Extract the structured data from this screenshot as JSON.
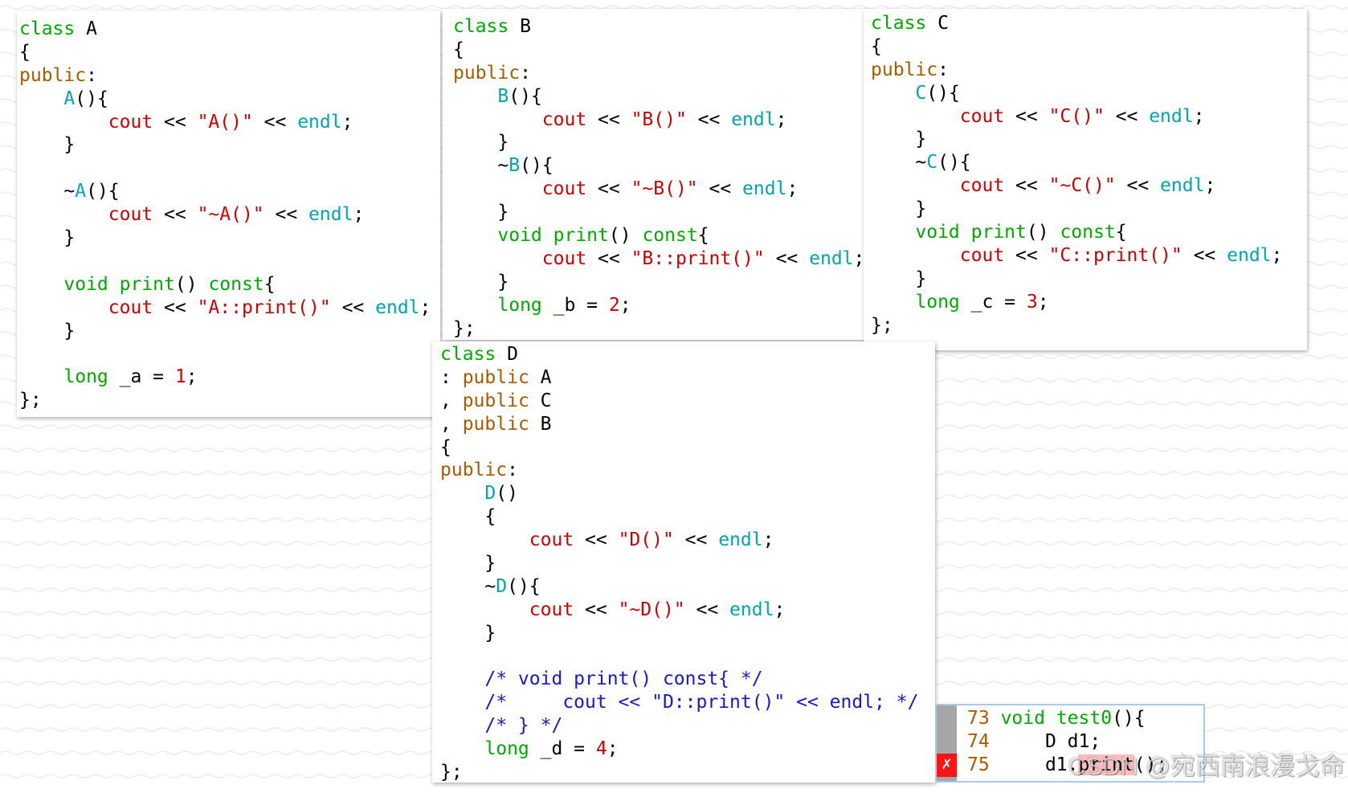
{
  "background": {
    "wave_color": "#ebebeb"
  },
  "panels": [
    {
      "lines": [
        [
          [
            "class",
            "#00aa00"
          ],
          [
            " A"
          ]
        ],
        [
          [
            "{"
          ]
        ],
        [
          [
            "public",
            "#aa5a00"
          ],
          [
            ":"
          ]
        ],
        [
          [
            "    "
          ],
          [
            "A",
            "#00a5b0"
          ],
          [
            "(){"
          ]
        ],
        [
          [
            "        "
          ],
          [
            "cout",
            "#d00000"
          ],
          [
            " << "
          ],
          [
            "\"A()\"",
            "#d00000"
          ],
          [
            " << "
          ],
          [
            "endl",
            "#00a5b0"
          ],
          [
            ";"
          ]
        ],
        [
          [
            "    }"
          ]
        ],
        [],
        [
          [
            "    ~"
          ],
          [
            "A",
            "#00a5b0"
          ],
          [
            "(){"
          ]
        ],
        [
          [
            "        "
          ],
          [
            "cout",
            "#d00000"
          ],
          [
            " << "
          ],
          [
            "\"~A()\"",
            "#d00000"
          ],
          [
            " << "
          ],
          [
            "endl",
            "#00a5b0"
          ],
          [
            ";"
          ]
        ],
        [
          [
            "    }"
          ]
        ],
        [],
        [
          [
            "    "
          ],
          [
            "void",
            "#00aa00"
          ],
          [
            " "
          ],
          [
            "print",
            "#00aa00"
          ],
          [
            "() "
          ],
          [
            "const",
            "#00aa00"
          ],
          [
            "{"
          ]
        ],
        [
          [
            "        "
          ],
          [
            "cout",
            "#d00000"
          ],
          [
            " << "
          ],
          [
            "\"A::print()\"",
            "#d00000"
          ],
          [
            " << "
          ],
          [
            "endl",
            "#00a5b0"
          ],
          [
            ";"
          ]
        ],
        [
          [
            "    }"
          ]
        ],
        [],
        [
          [
            "    "
          ],
          [
            "long",
            "#00aa00"
          ],
          [
            " _a = "
          ],
          [
            "1",
            "#d00000"
          ],
          [
            ";"
          ]
        ],
        [
          [
            "};"
          ]
        ]
      ]
    },
    {
      "lines": [
        [
          [
            "class",
            "#00aa00"
          ],
          [
            " B"
          ]
        ],
        [
          [
            "{"
          ]
        ],
        [
          [
            "public",
            "#aa5a00"
          ],
          [
            ":"
          ]
        ],
        [
          [
            "    "
          ],
          [
            "B",
            "#00a5b0"
          ],
          [
            "(){"
          ]
        ],
        [
          [
            "        "
          ],
          [
            "cout",
            "#d00000"
          ],
          [
            " << "
          ],
          [
            "\"B()\"",
            "#d00000"
          ],
          [
            " << "
          ],
          [
            "endl",
            "#00a5b0"
          ],
          [
            ";"
          ]
        ],
        [
          [
            "    }"
          ]
        ],
        [
          [
            "    ~"
          ],
          [
            "B",
            "#00a5b0"
          ],
          [
            "(){"
          ]
        ],
        [
          [
            "        "
          ],
          [
            "cout",
            "#d00000"
          ],
          [
            " << "
          ],
          [
            "\"~B()\"",
            "#d00000"
          ],
          [
            " << "
          ],
          [
            "endl",
            "#00a5b0"
          ],
          [
            ";"
          ]
        ],
        [
          [
            "    }"
          ]
        ],
        [
          [
            "    "
          ],
          [
            "void",
            "#00aa00"
          ],
          [
            " "
          ],
          [
            "print",
            "#00aa00"
          ],
          [
            "() "
          ],
          [
            "const",
            "#00aa00"
          ],
          [
            "{"
          ]
        ],
        [
          [
            "        "
          ],
          [
            "cout",
            "#d00000"
          ],
          [
            " << "
          ],
          [
            "\"B::print()\"",
            "#d00000"
          ],
          [
            " << "
          ],
          [
            "endl",
            "#00a5b0"
          ],
          [
            ";"
          ]
        ],
        [
          [
            "    }"
          ]
        ],
        [
          [
            "    "
          ],
          [
            "long",
            "#00aa00"
          ],
          [
            " _b = "
          ],
          [
            "2",
            "#d00000"
          ],
          [
            ";"
          ]
        ],
        [
          [
            "};"
          ]
        ]
      ]
    },
    {
      "lines": [
        [
          [
            "class",
            "#00aa00"
          ],
          [
            " C"
          ]
        ],
        [
          [
            "{"
          ]
        ],
        [
          [
            "public",
            "#aa5a00"
          ],
          [
            ":"
          ]
        ],
        [
          [
            "    "
          ],
          [
            "C",
            "#00a5b0"
          ],
          [
            "(){"
          ]
        ],
        [
          [
            "        "
          ],
          [
            "cout",
            "#d00000"
          ],
          [
            " << "
          ],
          [
            "\"C()\"",
            "#d00000"
          ],
          [
            " << "
          ],
          [
            "endl",
            "#00a5b0"
          ],
          [
            ";"
          ]
        ],
        [
          [
            "    }"
          ]
        ],
        [
          [
            "    ~"
          ],
          [
            "C",
            "#00a5b0"
          ],
          [
            "(){"
          ]
        ],
        [
          [
            "        "
          ],
          [
            "cout",
            "#d00000"
          ],
          [
            " << "
          ],
          [
            "\"~C()\"",
            "#d00000"
          ],
          [
            " << "
          ],
          [
            "endl",
            "#00a5b0"
          ],
          [
            ";"
          ]
        ],
        [
          [
            "    }"
          ]
        ],
        [
          [
            "    "
          ],
          [
            "void",
            "#00aa00"
          ],
          [
            " "
          ],
          [
            "print",
            "#00aa00"
          ],
          [
            "() "
          ],
          [
            "const",
            "#00aa00"
          ],
          [
            "{"
          ]
        ],
        [
          [
            "        "
          ],
          [
            "cout",
            "#d00000"
          ],
          [
            " << "
          ],
          [
            "\"C::print()\"",
            "#d00000"
          ],
          [
            " << "
          ],
          [
            "endl",
            "#00a5b0"
          ],
          [
            ";"
          ]
        ],
        [
          [
            "    }"
          ]
        ],
        [
          [
            "    "
          ],
          [
            "long",
            "#00aa00"
          ],
          [
            " _c = "
          ],
          [
            "3",
            "#d00000"
          ],
          [
            ";"
          ]
        ],
        [
          [
            "};"
          ]
        ]
      ]
    },
    {
      "lines": [
        [
          [
            "class",
            "#00aa00"
          ],
          [
            " D"
          ]
        ],
        [
          [
            ": "
          ],
          [
            "public",
            "#aa5a00"
          ],
          [
            " A"
          ]
        ],
        [
          [
            ", "
          ],
          [
            "public",
            "#aa5a00"
          ],
          [
            " C"
          ]
        ],
        [
          [
            ", "
          ],
          [
            "public",
            "#aa5a00"
          ],
          [
            " B"
          ]
        ],
        [
          [
            "{"
          ]
        ],
        [
          [
            "public",
            "#aa5a00"
          ],
          [
            ":"
          ]
        ],
        [
          [
            "    "
          ],
          [
            "D",
            "#00a5b0"
          ],
          [
            "()"
          ]
        ],
        [
          [
            "    {"
          ]
        ],
        [
          [
            "        "
          ],
          [
            "cout",
            "#d00000"
          ],
          [
            " << "
          ],
          [
            "\"D()\"",
            "#d00000"
          ],
          [
            " << "
          ],
          [
            "endl",
            "#00a5b0"
          ],
          [
            ";"
          ]
        ],
        [
          [
            "    }"
          ]
        ],
        [
          [
            "    ~"
          ],
          [
            "D",
            "#00a5b0"
          ],
          [
            "(){"
          ]
        ],
        [
          [
            "        "
          ],
          [
            "cout",
            "#d00000"
          ],
          [
            " << "
          ],
          [
            "\"~D()\"",
            "#d00000"
          ],
          [
            " << "
          ],
          [
            "endl",
            "#00a5b0"
          ],
          [
            ";"
          ]
        ],
        [
          [
            "    }"
          ]
        ],
        [],
        [
          [
            "    "
          ],
          [
            "/* void print() const{ */",
            "#1818d0"
          ]
        ],
        [
          [
            "    "
          ],
          [
            "/*     cout << \"D::print()\" << endl; */",
            "#1818d0"
          ]
        ],
        [
          [
            "    "
          ],
          [
            "/* } */",
            "#1818d0"
          ]
        ],
        [
          [
            "    "
          ],
          [
            "long",
            "#00aa00"
          ],
          [
            " _d = "
          ],
          [
            "4",
            "#d00000"
          ],
          [
            ";"
          ]
        ],
        [
          [
            "};"
          ]
        ]
      ]
    }
  ],
  "editor": {
    "border_color": "#a9c9ee",
    "sign_column_color": "#a6a6a6",
    "error_sign_color": "#ff1414",
    "line_number_color": "#aa5a00",
    "lines": [
      {
        "number": "73",
        "tokens": [
          [
            " "
          ],
          [
            "void",
            "#00aa00"
          ],
          [
            " "
          ],
          [
            "test0",
            "#00aa00"
          ],
          [
            "(){"
          ]
        ]
      },
      {
        "number": "74",
        "tokens": [
          [
            "     D d1;"
          ]
        ]
      },
      {
        "number": "75",
        "sign": "✗",
        "tokens": [
          [
            "     d1."
          ],
          [
            "print",
            "#000000",
            "#ffbdbd"
          ],
          [
            "();"
          ]
        ]
      }
    ]
  },
  "watermark": "CSDN @宛西南浪漫戈命"
}
